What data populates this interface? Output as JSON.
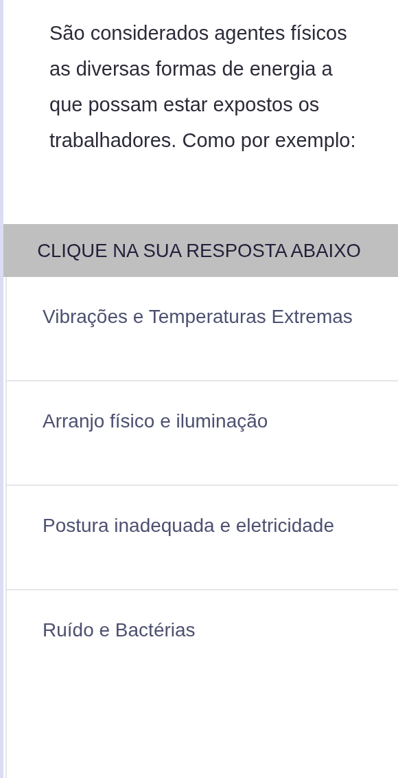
{
  "question": "São considerados agentes físicos as diversas formas de energia a que possam estar expostos os trabalhadores. Como por exemplo:",
  "banner": "CLIQUE NA SUA RESPOSTA ABAIXO",
  "options": [
    {
      "label": "Vibrações e Temperaturas Extremas"
    },
    {
      "label": "Arranjo físico e iluminação"
    },
    {
      "label": "Postura inadequada e eletricidade"
    },
    {
      "label": "Ruído e Bactérias"
    }
  ]
}
